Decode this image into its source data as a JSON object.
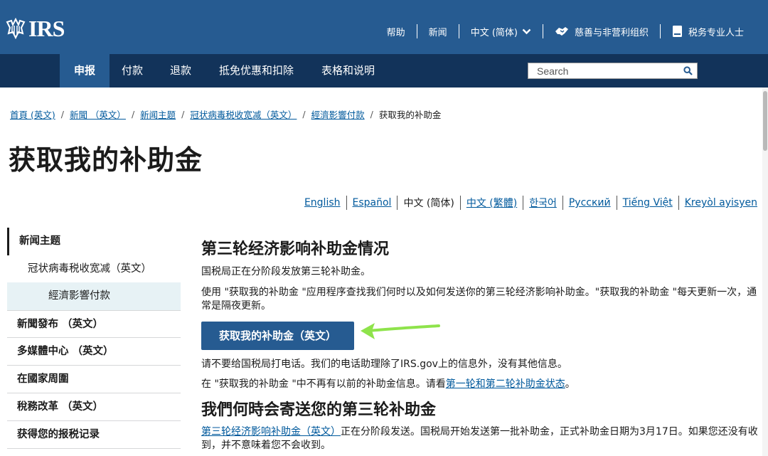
{
  "header": {
    "logo_text": "IRS",
    "links": [
      {
        "label": "帮助"
      },
      {
        "label": "新闻"
      },
      {
        "label": "中文 (简体)"
      },
      {
        "label": "慈善与非营利组织"
      },
      {
        "label": "税务专业人士"
      }
    ]
  },
  "nav": {
    "items": [
      {
        "label": "申报"
      },
      {
        "label": "付款"
      },
      {
        "label": "退款"
      },
      {
        "label": "抵免优惠和扣除"
      },
      {
        "label": "表格和说明"
      }
    ],
    "search_placeholder": "Search"
  },
  "breadcrumb": [
    {
      "label": "首頁 (英文)"
    },
    {
      "label": "新聞 （英文）"
    },
    {
      "label": "新闻主题"
    },
    {
      "label": "冠状病毒税收宽减（英文）"
    },
    {
      "label": "經濟影響付款"
    },
    {
      "label": "获取我的补助金"
    }
  ],
  "page_title": "获取我的补助金",
  "languages": [
    {
      "label": "English"
    },
    {
      "label": "Español"
    },
    {
      "label": "中文 (简体)"
    },
    {
      "label": "中文 (繁體)"
    },
    {
      "label": "한국어"
    },
    {
      "label": "Русский"
    },
    {
      "label": "Tiếng Việt"
    },
    {
      "label": "Kreyòl ayisyen"
    }
  ],
  "sidebar": {
    "items": [
      {
        "label": "新闻主题"
      },
      {
        "label": "冠状病毒税收宽减（英文）"
      },
      {
        "label": "經濟影響付款"
      },
      {
        "label": "新聞發布 （英文）"
      },
      {
        "label": "多媒體中心 （英文）"
      },
      {
        "label": "在國家周圍"
      },
      {
        "label": "稅務改革 （英文）"
      },
      {
        "label": "获得您的报税记录"
      }
    ]
  },
  "main": {
    "section1_heading": "第三轮经济影响补助金情况",
    "para1": "国税局正在分阶段发放第三轮补助金。",
    "para2": "使用 \"获取我的补助金 \"应用程序查找我们何时以及如何发送你的第三轮经济影响补助金。\"获取我的补助金 \"每天更新一次，通常是隔夜更新。",
    "button_label": "获取我的补助金（英文）",
    "para3": "请不要给国税局打电话。我们的电话助理除了IRS.gov上的信息外，没有其他信息。",
    "para4_text": "在 \"获取我的补助金 \"中不再有以前的补助金信息。请看",
    "para4_link": "第一轮和第二轮补助金状态",
    "para4_end": "。",
    "section2_heading": "我們何時会寄送您的第三轮补助金",
    "para5_link": "第三轮经济影响补助金（英文）",
    "para5_text": "正在分阶段发送。国税局开始发送第一批补助金，正式补助金日期为3月17日。如果您还没有收到，并不意味着您不会收到。"
  },
  "colors": {
    "header_blue": "#265b91",
    "nav_dark": "#12335a",
    "link_blue": "#00599c",
    "arrow_green": "#8ee34b"
  }
}
